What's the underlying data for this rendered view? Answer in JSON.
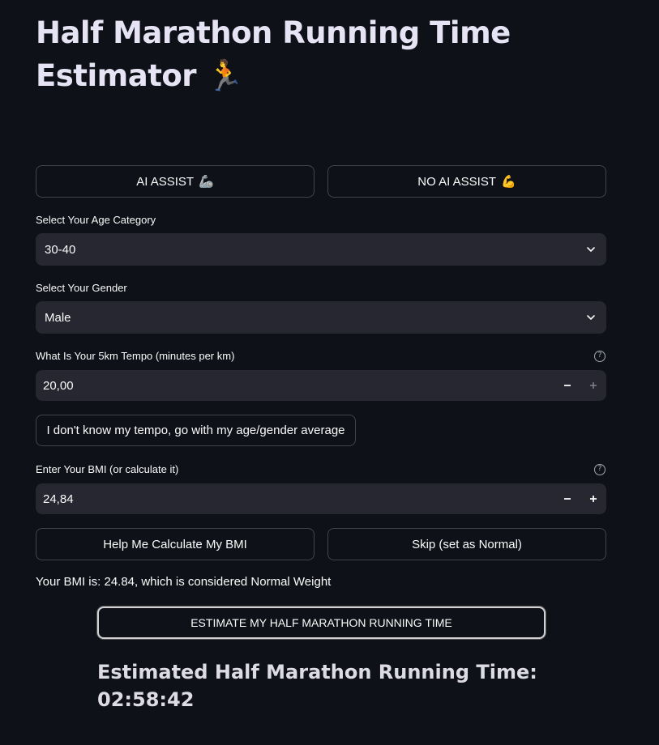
{
  "header": {
    "title": "Half Marathon Running Time Estimator",
    "title_emoji": "🏃"
  },
  "mode_buttons": {
    "ai_assist": {
      "label": "AI ASSIST",
      "emoji": "🦾"
    },
    "no_ai_assist": {
      "label": "NO AI ASSIST",
      "emoji": "💪"
    }
  },
  "age": {
    "label": "Select Your Age Category",
    "value": "30-40"
  },
  "gender": {
    "label": "Select Your Gender",
    "value": "Male"
  },
  "tempo": {
    "label": "What Is Your 5km Tempo (minutes per km)",
    "value": "20,00",
    "fallback_button": "I don't know my tempo, go with my age/gender average"
  },
  "bmi": {
    "label": "Enter Your BMI (or calculate it)",
    "value": "24,84",
    "calc_button": "Help Me Calculate My BMI",
    "skip_button": "Skip (set as Normal)",
    "status_text": "Your BMI is: 24.84, which is considered Normal Weight"
  },
  "estimate_button": "ESTIMATE MY HALF MARATHON RUNNING TIME",
  "result": {
    "label": "Estimated Half Marathon Running Time:",
    "time": "02:58:42"
  },
  "colors": {
    "background": "#0e1117",
    "input_bg": "#262730",
    "text": "#fafafa"
  }
}
